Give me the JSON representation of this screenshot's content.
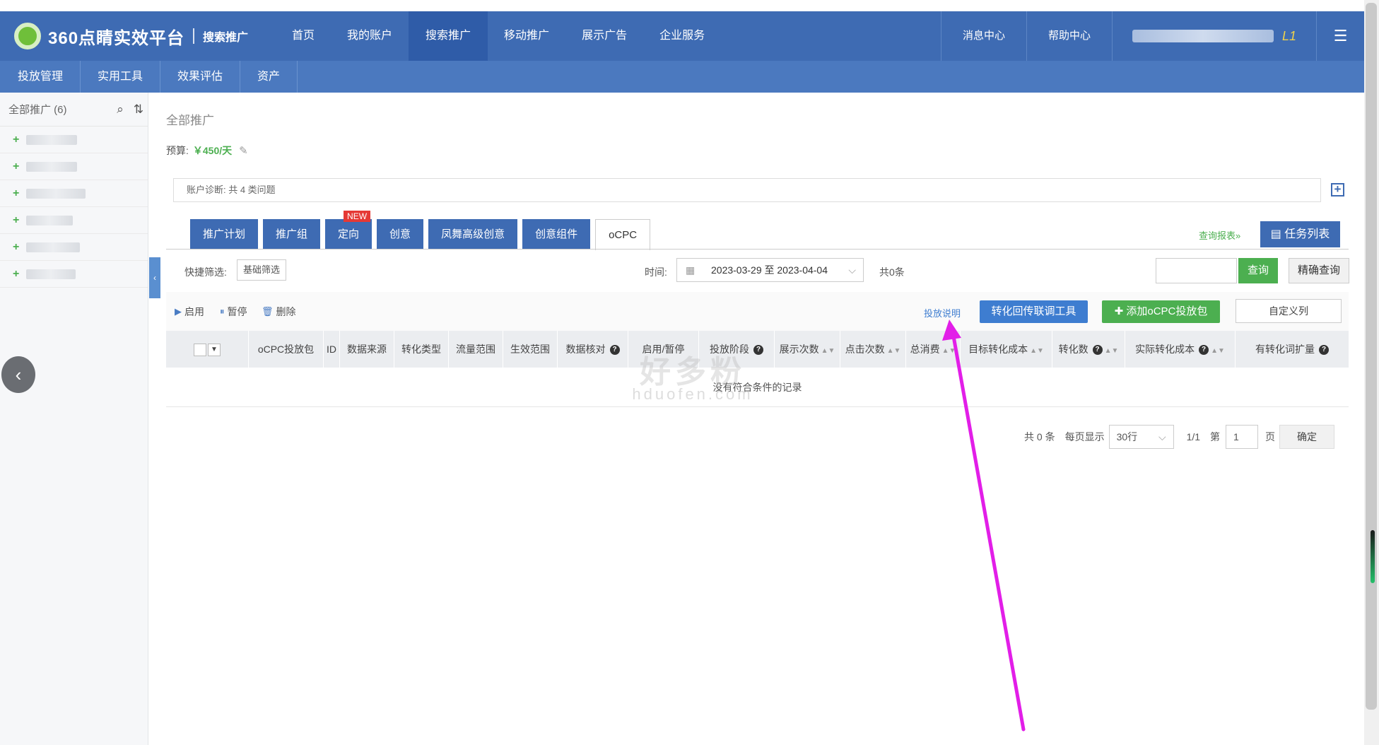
{
  "app": {
    "logo_text": "360点睛实效平台",
    "product": "搜索推广"
  },
  "nav": {
    "items": [
      "首页",
      "我的账户",
      "搜索推广",
      "移动推广",
      "展示广告",
      "企业服务"
    ],
    "active_index": 2,
    "right": [
      "消息中心",
      "帮助中心"
    ],
    "user_tag": "L1"
  },
  "subnav": [
    "投放管理",
    "实用工具",
    "效果评估",
    "资产"
  ],
  "sidebar": {
    "title": "全部推广 (6)",
    "item_count": 6
  },
  "main": {
    "page_title": "全部推广",
    "budget_label": "预算:",
    "budget_value": "￥450/天",
    "diagnosis": "账户诊断: 共 4 类问题",
    "tabs": [
      "推广计划",
      "推广组",
      "定向",
      "创意",
      "凤舞高级创意",
      "创意组件",
      "oCPC"
    ],
    "new_badge": "NEW",
    "active_tab": "oCPC",
    "query_report": "查询报表»",
    "task_list": "任务列表",
    "quick_filter_label": "快捷筛选:",
    "quick_filter_chip": "基础筛选",
    "time_label": "时间:",
    "date_range": "2023-03-29 至 2023-04-04",
    "count": "共0条",
    "search_btn": "查询",
    "precise_btn": "精确查询",
    "actions": {
      "enable": "启用",
      "pause": "暂停",
      "delete": "删除"
    },
    "doc_link": "投放说明",
    "tool_btn": "转化回传联调工具",
    "add_btn": "添加oCPC投放包",
    "custom_btn": "自定义列",
    "columns": [
      "oCPC投放包",
      "ID",
      "数据来源",
      "转化类型",
      "流量范围",
      "生效范围",
      "数据核对",
      "启用/暂停",
      "投放阶段",
      "展示次数",
      "点击次数",
      "总消费",
      "目标转化成本",
      "转化数",
      "实际转化成本",
      "有转化词扩量"
    ],
    "empty_text": "没有符合条件的记录",
    "pager": {
      "total": "共 0 条",
      "per_page_label": "每页显示",
      "per_page": "30行",
      "pages": "1/1",
      "goto_label": "第",
      "goto_value": "1",
      "page_unit": "页",
      "confirm": "确定"
    }
  },
  "watermark": {
    "text": "好多粉",
    "sub": "hduofen.com"
  },
  "colors": {
    "nav": "#3e6bb3",
    "green": "#4caf50",
    "arrow": "#e21ee8"
  }
}
